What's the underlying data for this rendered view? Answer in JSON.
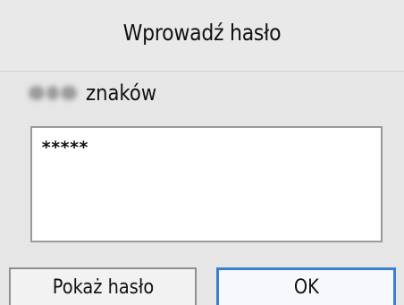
{
  "dialog": {
    "title": "Wprowadź hasło"
  },
  "counter": {
    "label": "znaków"
  },
  "password": {
    "value": "*****"
  },
  "buttons": {
    "show_password_label": "Pokaż hasło",
    "ok_label": "OK"
  },
  "colors": {
    "background": "#e6e6e6",
    "field_background": "#ffffff",
    "field_border": "#9a9a9a",
    "focus_border": "#3b7fd4"
  }
}
